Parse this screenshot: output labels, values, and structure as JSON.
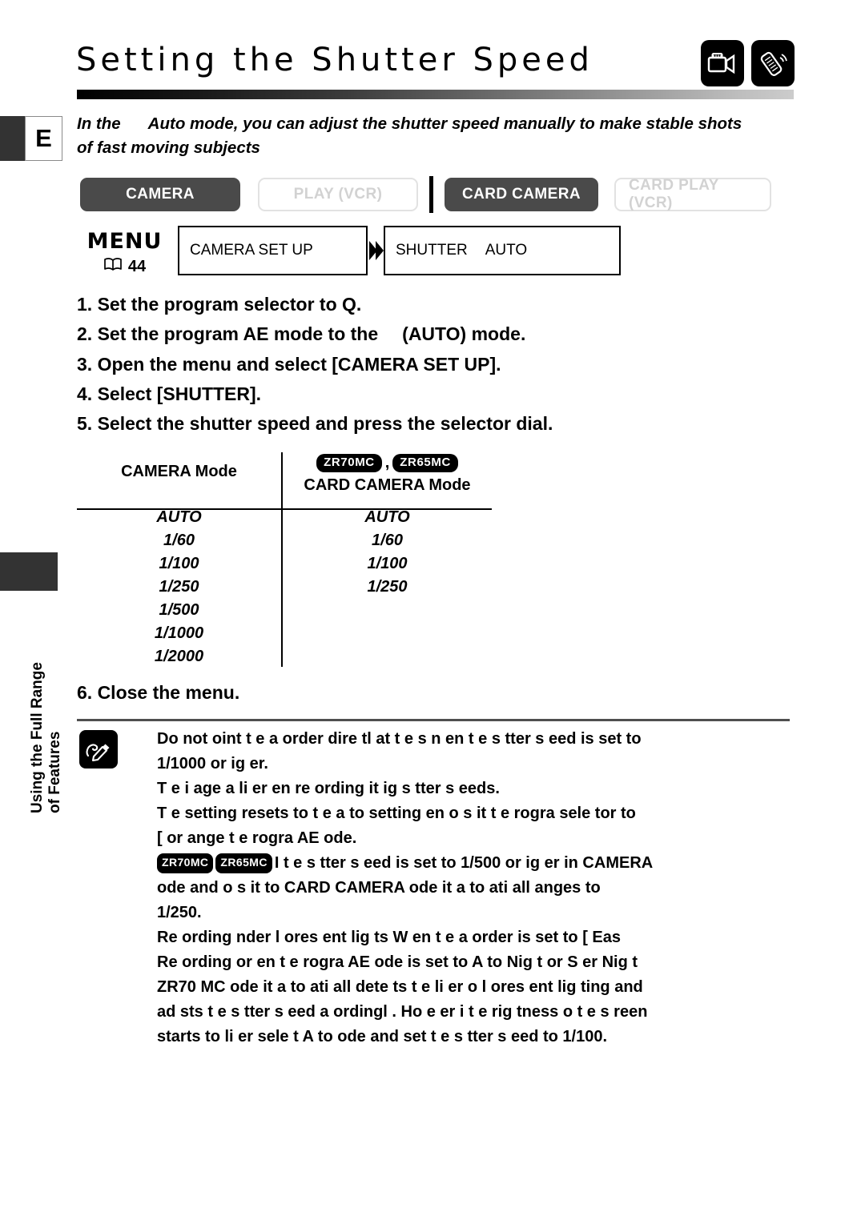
{
  "page": {
    "language_tab": "E",
    "side_tab_line1": "Using the Full Range",
    "side_tab_line2": "of Features"
  },
  "header": {
    "title": "Setting the Shutter Speed",
    "icons": [
      "camcorder-icon",
      "remote-control-icon"
    ]
  },
  "intro": {
    "line1_a": "In the",
    "line1_b": "Auto mode, you can adjust the shutter speed manually to make stable shots",
    "line2": "of fast moving subjects"
  },
  "modes": {
    "buttons": [
      {
        "label": "CAMERA",
        "state": "on"
      },
      {
        "label": "PLAY (VCR)",
        "state": "off"
      },
      {
        "label": "CARD CAMERA",
        "state": "on"
      },
      {
        "label": "CARD PLAY (VCR)",
        "state": "off"
      }
    ]
  },
  "menu": {
    "label": "MENU",
    "page_ref": "44",
    "book_icon": "book-icon",
    "box1": "CAMERA SET UP",
    "box2_name": "SHUTTER",
    "box2_value": "AUTO",
    "arrow_icon": "double-arrow-right-icon"
  },
  "steps": {
    "s1_a": "1. Set the program selector to",
    "s1_b": "Q.",
    "s2_a": "2. Set the program AE mode to the",
    "s2_b": "(AUTO) mode.",
    "s3": "3. Open the menu and select [CAMERA SET UP].",
    "s4": "4. Select [SHUTTER].",
    "s5": "5. Select the shutter speed and press the selector dial.",
    "s6": "6. Close the menu."
  },
  "table": {
    "col_a_header": "CAMERA Mode",
    "col_b_badges": [
      "ZR70MC",
      "ZR65MC"
    ],
    "col_b_badge_sep": ",",
    "col_b_header": "CARD CAMERA Mode",
    "col_a_values": [
      "AUTO",
      "1/60",
      "1/100",
      "1/250",
      "1/500",
      "1/1000",
      "1/2000"
    ],
    "col_b_values": [
      "AUTO",
      "1/60",
      "1/100",
      "1/250"
    ]
  },
  "notes": {
    "icon": "pencil-note-icon",
    "n1_l1": "Do not  oint t e a   order dire tl  at t e s n   en t e s  tter s eed is set to",
    "n1_l2": "1/1000 or  ig er.",
    "n2_l1": "T e i age  a  li er   en re ording  it  ig  s  tter s eeds.",
    "n3_l1": "T e setting resets to t e a to setting   en o s it  t e  rogra  sele tor to",
    "n3_l2": "[   or   ange t e  rogra  AE  ode.",
    "n4_badge1": "ZR70MC",
    "n4_badge2": "ZR65MC",
    "n4_l1": "I  t e s   tter s eed is set to 1/500 or  ig er in CAMERA",
    "n4_l2": " ode and  o s it   to CARD CAMERA   ode it a to  ati all   anges to",
    "n4_l3": "1/250.",
    "n5_l1": "Re ording  nder  l ores ent lig ts W en t e a   order is set to [    Eas",
    "n5_l2": "Re ording  or   en t e  rogra  AE  ode is set to A to Nig t or S  er Nig t",
    "n5_l3": " ZR70 MC   ode it a to  ati all  dete ts t e  li  er o  l ores ent lig ting and",
    "n5_l4": "ad  sts t e s  tter s eed a  ordingl . Ho e er i  t e  rig tness o  t e s reen",
    "n5_l5": "starts to  li  er sele t A to   ode and set t e s  tter s eed to 1/100."
  }
}
